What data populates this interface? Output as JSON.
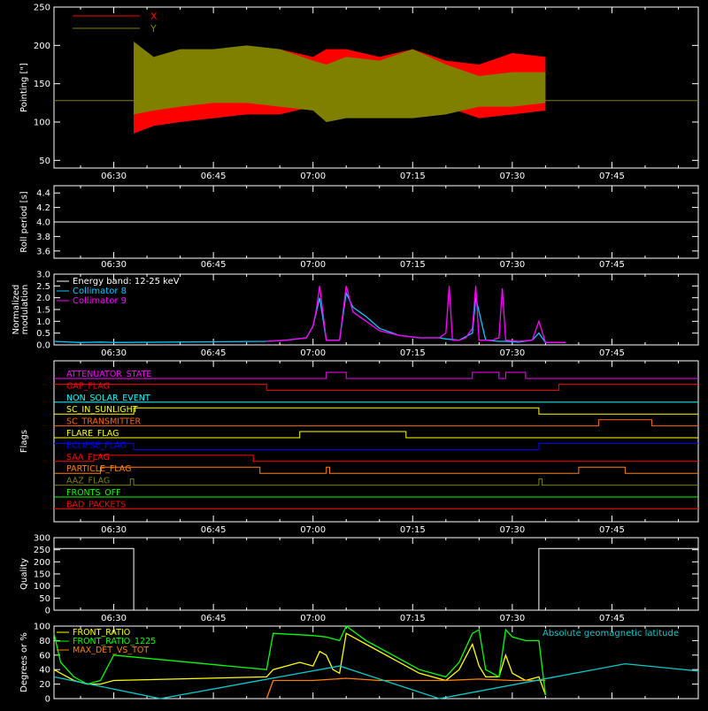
{
  "colors": {
    "background": "#000000",
    "axis": "#ffffff",
    "x_series": "#ff0000",
    "y_series": "#808000",
    "pointing_center": "#808000",
    "roll": "#ffffff",
    "energy_band": "#ffffff",
    "collimator8": "#00c8ff",
    "collimator9": "#ff00ff",
    "quality": "#ffffff",
    "front_ratio": "#ffff00",
    "front_ratio_1225": "#00ff00",
    "max_det": "#ff8000",
    "geomag": "#00cccc"
  },
  "chart_data": [
    {
      "type": "area",
      "ylabel": "Pointing [\"]",
      "ylim": [
        40,
        250
      ],
      "yticks": [
        50,
        100,
        150,
        200,
        250
      ],
      "xticks": [
        "06:30",
        "06:45",
        "07:00",
        "07:15",
        "07:30",
        "07:45"
      ],
      "legend": [
        "X",
        "Y"
      ],
      "baseline": 128,
      "active_window": [
        "06:33",
        "07:35"
      ],
      "series": [
        {
          "name": "X",
          "x": [
            "06:33",
            "06:36",
            "06:40",
            "06:45",
            "06:50",
            "06:55",
            "07:00",
            "07:02",
            "07:05",
            "07:10",
            "07:15",
            "07:20",
            "07:25",
            "07:30",
            "07:35"
          ],
          "upper": [
            195,
            180,
            185,
            190,
            195,
            195,
            185,
            195,
            195,
            185,
            195,
            180,
            175,
            190,
            185
          ],
          "lower": [
            85,
            95,
            100,
            105,
            110,
            110,
            120,
            120,
            125,
            125,
            120,
            120,
            105,
            110,
            115
          ]
        },
        {
          "name": "Y",
          "x": [
            "06:33",
            "06:36",
            "06:40",
            "06:45",
            "06:50",
            "06:55",
            "07:00",
            "07:02",
            "07:05",
            "07:10",
            "07:15",
            "07:20",
            "07:25",
            "07:30",
            "07:35"
          ],
          "upper": [
            205,
            185,
            195,
            195,
            200,
            195,
            180,
            175,
            185,
            180,
            195,
            175,
            160,
            165,
            165
          ],
          "lower": [
            110,
            115,
            120,
            125,
            125,
            120,
            115,
            100,
            105,
            105,
            105,
            110,
            120,
            120,
            125
          ]
        }
      ]
    },
    {
      "type": "line",
      "ylabel": "Roll period [s]",
      "ylim": [
        3.5,
        4.5
      ],
      "yticks": [
        3.6,
        3.8,
        4.0,
        4.2,
        4.4
      ],
      "xticks": [
        "06:30",
        "06:45",
        "07:00",
        "07:15",
        "07:30",
        "07:45"
      ],
      "series": [
        {
          "x": [
            "06:21",
            "07:58"
          ],
          "y": [
            4.0,
            4.0
          ]
        }
      ]
    },
    {
      "type": "line",
      "ylabel": "Normalized modulation",
      "ylim": [
        0,
        3.0
      ],
      "yticks": [
        0.0,
        0.5,
        1.0,
        1.5,
        2.0,
        2.5,
        3.0
      ],
      "xticks": [
        "06:30",
        "06:45",
        "07:00",
        "07:15",
        "07:30",
        "07:45"
      ],
      "legend": [
        "Energy band: 12-25 keV",
        "Collimator 8",
        "Collimator 9"
      ],
      "series": [
        {
          "name": "Collimator 8",
          "x": [
            "06:21",
            "06:25",
            "06:28",
            "06:30",
            "06:53",
            "06:56",
            "06:59",
            "07:00",
            "07:01",
            "07:02",
            "07:04",
            "07:05",
            "07:06",
            "07:08",
            "07:10",
            "07:13",
            "07:16",
            "07:19",
            "07:20",
            "07:22",
            "07:24",
            "07:24.5",
            "07:26",
            "07:28",
            "07:29",
            "07:31",
            "07:33",
            "07:34",
            "07:35",
            "07:38"
          ],
          "y": [
            0.15,
            0.1,
            0.12,
            0.1,
            0.15,
            0.2,
            0.3,
            0.8,
            2.0,
            0.2,
            0.2,
            2.2,
            1.6,
            1.2,
            0.7,
            0.4,
            0.3,
            0.3,
            0.25,
            0.2,
            0.5,
            2.0,
            0.2,
            0.15,
            0.15,
            0.12,
            0.2,
            0.5,
            0.1,
            0.1
          ]
        },
        {
          "name": "Collimator 9",
          "x": [
            "06:53",
            "06:56",
            "06:59",
            "07:00",
            "07:00.5",
            "07:01",
            "07:02",
            "07:04",
            "07:05",
            "07:06",
            "07:08",
            "07:10",
            "07:13",
            "07:16",
            "07:19",
            "07:20",
            "07:20.5",
            "07:21",
            "07:22",
            "07:23",
            "07:24",
            "07:24.5",
            "07:25",
            "07:27",
            "07:28",
            "07:28.5",
            "07:29",
            "07:31",
            "07:33",
            "07:34",
            "07:35",
            "07:38"
          ],
          "y": [
            0.15,
            0.2,
            0.3,
            0.8,
            1.5,
            2.5,
            0.2,
            0.2,
            2.5,
            1.4,
            1.0,
            0.6,
            0.4,
            0.3,
            0.3,
            0.5,
            2.5,
            0.2,
            0.2,
            0.3,
            0.7,
            2.5,
            0.2,
            0.2,
            0.3,
            2.4,
            0.2,
            0.15,
            0.2,
            1.0,
            0.1,
            0.1
          ]
        }
      ]
    },
    {
      "type": "line",
      "ylabel": "Flags",
      "xticks": [
        "06:30",
        "06:45",
        "07:00",
        "07:15",
        "07:30",
        "07:45"
      ],
      "series": [
        {
          "name": "ATTENUATOR_STATE",
          "color": "#ff00ff",
          "x": [
            "06:21",
            "07:02",
            "07:02",
            "07:05",
            "07:05",
            "07:24",
            "07:24",
            "07:28",
            "07:28",
            "07:29",
            "07:29",
            "07:32",
            "07:32",
            "07:58"
          ],
          "y": [
            0,
            0,
            1,
            1,
            0,
            0,
            1,
            1,
            0,
            0,
            1,
            1,
            0,
            0
          ]
        },
        {
          "name": "GAP_FLAG",
          "color": "#ff0000",
          "x": [
            "06:21",
            "06:53",
            "06:53",
            "07:37",
            "07:37",
            "07:58"
          ],
          "y": [
            1,
            1,
            0,
            0,
            1,
            1
          ]
        },
        {
          "name": "NON_SOLAR_EVENT",
          "color": "#00ffff",
          "x": [
            "06:21",
            "07:58"
          ],
          "y": [
            0,
            0
          ]
        },
        {
          "name": "SC_IN_SUNLIGHT",
          "color": "#ffff00",
          "x": [
            "06:21",
            "06:33",
            "06:33",
            "07:34",
            "07:34",
            "07:58"
          ],
          "y": [
            0,
            0,
            1,
            1,
            0,
            0
          ]
        },
        {
          "name": "SC_TRANSMITTER",
          "color": "#ff6600",
          "x": [
            "06:21",
            "07:43",
            "07:43",
            "07:51",
            "07:51",
            "07:58"
          ],
          "y": [
            0,
            0,
            1,
            1,
            0,
            0
          ]
        },
        {
          "name": "FLARE_FLAG",
          "color": "#ffff00",
          "x": [
            "06:21",
            "06:58",
            "06:58",
            "07:14",
            "07:14",
            "07:34",
            "07:34",
            "07:58"
          ],
          "y": [
            0,
            0,
            1,
            1,
            0,
            0,
            0,
            0
          ]
        },
        {
          "name": "ECLIPSE_FLAG",
          "color": "#0000ff",
          "x": [
            "06:21",
            "06:33",
            "06:33",
            "07:34",
            "07:34",
            "07:58"
          ],
          "y": [
            1,
            1,
            0,
            0,
            1,
            1
          ]
        },
        {
          "name": "SAA_FLAG",
          "color": "#ff0000",
          "x": [
            "06:21",
            "06:27",
            "06:27",
            "06:51",
            "06:51",
            "07:58"
          ],
          "y": [
            0,
            0,
            1,
            1,
            0,
            0
          ]
        },
        {
          "name": "PARTICLE_FLAG",
          "color": "#ff8000",
          "x": [
            "06:21",
            "06:28",
            "06:28",
            "06:52",
            "06:52",
            "07:02",
            "07:02",
            "07:02.5",
            "07:02.5",
            "07:40",
            "07:40",
            "07:47",
            "07:47",
            "07:58"
          ],
          "y": [
            0,
            0,
            1,
            1,
            0,
            0,
            1,
            1,
            0,
            0,
            1,
            1,
            0,
            0
          ]
        },
        {
          "name": "AAZ_FLAG",
          "color": "#808000",
          "x": [
            "06:21",
            "06:32.5",
            "06:32.5",
            "06:33",
            "06:33",
            "07:34",
            "07:34",
            "07:34.5",
            "07:34.5",
            "07:58"
          ],
          "y": [
            0,
            0,
            1,
            1,
            0,
            0,
            1,
            1,
            0,
            0
          ]
        },
        {
          "name": "FRONTS_OFF",
          "color": "#00ff00",
          "x": [
            "06:21",
            "07:58"
          ],
          "y": [
            0,
            0
          ]
        },
        {
          "name": "BAD_PACKETS",
          "color": "#ff0000",
          "x": [
            "06:21",
            "07:58"
          ],
          "y": [
            0,
            0
          ]
        }
      ]
    },
    {
      "type": "line",
      "ylabel": "Quality",
      "ylim": [
        0,
        300
      ],
      "yticks": [
        0,
        50,
        100,
        150,
        200,
        250,
        300
      ],
      "xticks": [
        "06:30",
        "06:45",
        "07:00",
        "07:15",
        "07:30",
        "07:45"
      ],
      "series": [
        {
          "x": [
            "06:21",
            "06:33",
            "06:33",
            "07:34",
            "07:34",
            "07:58"
          ],
          "y": [
            255,
            255,
            0,
            0,
            255,
            255
          ]
        }
      ]
    },
    {
      "type": "line",
      "ylabel": "Degrees or %",
      "ylim": [
        0,
        100
      ],
      "yticks": [
        0,
        20,
        40,
        60,
        80,
        100
      ],
      "xticks": [
        "06:30",
        "06:45",
        "07:00",
        "07:15",
        "07:30",
        "07:45"
      ],
      "legend": [
        "FRONT_RATIO",
        "FRONT_RATIO_1225",
        "MAX_DET_VS_TOT"
      ],
      "annotation": "Absolute geomagnetic latitude",
      "series": [
        {
          "name": "FRONT_RATIO",
          "x": [
            "06:21",
            "06:22",
            "06:24",
            "06:26",
            "06:28",
            "06:30",
            "06:53",
            "06:54",
            "06:58",
            "07:00",
            "07:01",
            "07:02",
            "07:03",
            "07:04",
            "07:05",
            "07:08",
            "07:12",
            "07:16",
            "07:20",
            "07:22",
            "07:24",
            "07:25",
            "07:26",
            "07:28",
            "07:29",
            "07:30",
            "07:32",
            "07:34",
            "07:35"
          ],
          "y": [
            40,
            35,
            25,
            20,
            20,
            25,
            30,
            40,
            50,
            45,
            65,
            60,
            40,
            35,
            90,
            75,
            55,
            35,
            25,
            40,
            75,
            45,
            30,
            30,
            60,
            35,
            25,
            30,
            5
          ]
        },
        {
          "name": "FRONT_RATIO_1225",
          "x": [
            "06:21",
            "06:22",
            "06:24",
            "06:26",
            "06:28",
            "06:30",
            "06:53",
            "06:54",
            "06:58",
            "07:00",
            "07:02",
            "07:04",
            "07:05",
            "07:08",
            "07:12",
            "07:16",
            "07:20",
            "07:22",
            "07:24",
            "07:25",
            "07:26",
            "07:28",
            "07:29",
            "07:30",
            "07:32",
            "07:34",
            "07:35"
          ],
          "y": [
            90,
            50,
            30,
            20,
            25,
            60,
            40,
            90,
            88,
            87,
            85,
            80,
            100,
            80,
            60,
            40,
            30,
            50,
            90,
            95,
            40,
            30,
            95,
            85,
            80,
            80,
            5
          ]
        },
        {
          "name": "MAX_DET_VS_TOT",
          "x": [
            "06:53",
            "06:54",
            "07:00",
            "07:05",
            "07:10",
            "07:15",
            "07:20",
            "07:25",
            "07:30",
            "07:35"
          ],
          "y": [
            0,
            25,
            25,
            28,
            25,
            25,
            25,
            27,
            25,
            25
          ]
        },
        {
          "name": "Absolute geomagnetic latitude",
          "x": [
            "06:21",
            "06:37",
            "07:04",
            "07:19",
            "07:47",
            "07:58"
          ],
          "y": [
            30,
            0,
            45,
            0,
            48,
            38
          ]
        }
      ]
    }
  ]
}
